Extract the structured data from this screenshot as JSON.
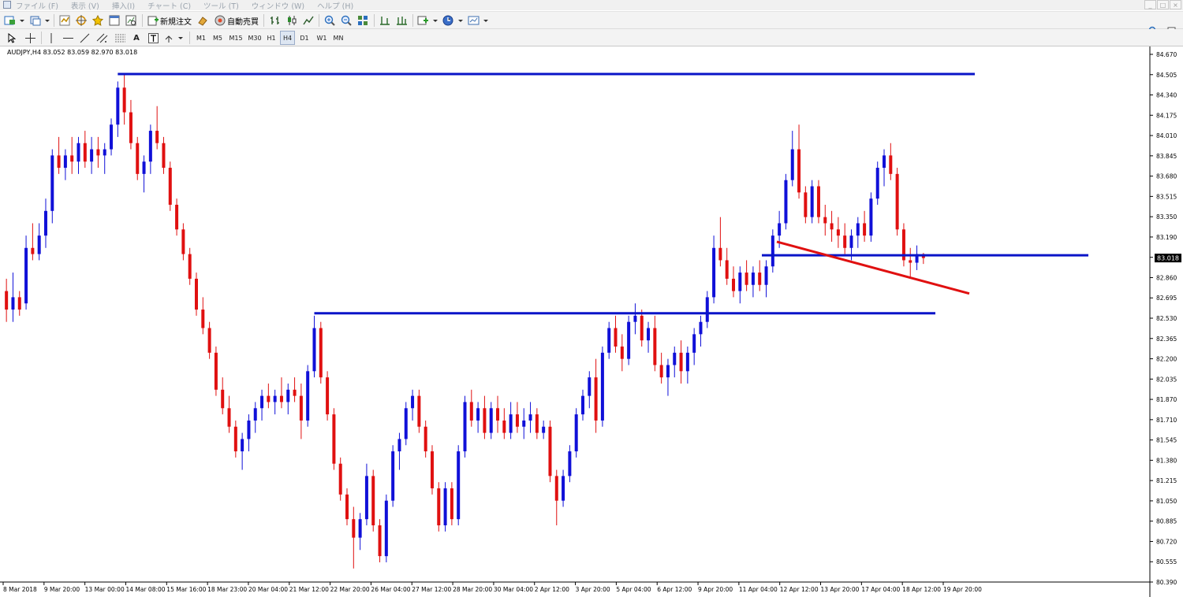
{
  "menu": {
    "items": [
      "ファイル (F)",
      "表示 (V)",
      "挿入(I)",
      "チャート (C)",
      "ツール (T)",
      "ウィンドウ (W)",
      "ヘルプ (H)"
    ],
    "window_controls": [
      "_",
      "□",
      "×"
    ]
  },
  "toolbar": {
    "new_order_label": "新規注文",
    "auto_trade_label": "自動売買",
    "timeframes": [
      "M1",
      "M5",
      "M15",
      "M30",
      "H1",
      "H4",
      "D1",
      "W1",
      "MN"
    ],
    "active_timeframe": "H4"
  },
  "chart": {
    "symbol_line": "AUDJPY,H4  83.052 83.059 82.970 83.018",
    "current_price_label": "83.018",
    "colors": {
      "bull": "#1010d8",
      "bear": "#e01010",
      "hline": "#0a14c8",
      "trendline": "#e01010",
      "price_tag_bg": "#000000"
    }
  },
  "chart_data": {
    "type": "candlestick",
    "price_axis_ticks": [
      "84.670",
      "84.505",
      "84.340",
      "84.175",
      "84.010",
      "83.845",
      "83.680",
      "83.515",
      "83.350",
      "83.190",
      "83.025",
      "82.860",
      "82.695",
      "82.530",
      "82.365",
      "82.200",
      "82.035",
      "81.870",
      "81.710",
      "81.545",
      "81.380",
      "81.215",
      "81.050",
      "80.885",
      "80.720",
      "80.555",
      "80.390"
    ],
    "time_axis_labels": [
      "8 Mar 2018",
      "9 Mar 20:00",
      "13 Mar 00:00",
      "14 Mar 08:00",
      "15 Mar 16:00",
      "18 Mar 23:00",
      "20 Mar 04:00",
      "21 Mar 12:00",
      "22 Mar 20:00",
      "26 Mar 04:00",
      "27 Mar 12:00",
      "28 Mar 20:00",
      "30 Mar 04:00",
      "2 Apr 12:00",
      "3 Apr 20:00",
      "5 Apr 04:00",
      "6 Apr 12:00",
      "9 Apr 20:00",
      "11 Apr 04:00",
      "12 Apr 12:00",
      "13 Apr 20:00",
      "17 Apr 04:00",
      "18 Apr 12:00",
      "19 Apr 20:00"
    ],
    "ylim": [
      80.39,
      84.67
    ],
    "horizontal_lines": [
      84.51,
      82.57,
      83.04
    ],
    "trendline": {
      "from_price": 83.15,
      "to_price": 82.73
    },
    "current_price": 83.018,
    "ohlc": [
      [
        82.75,
        82.85,
        82.5,
        82.6
      ],
      [
        82.6,
        82.9,
        82.5,
        82.7
      ],
      [
        82.7,
        82.75,
        82.55,
        82.6
      ],
      [
        82.65,
        83.2,
        82.6,
        83.1
      ],
      [
        83.1,
        83.3,
        83.0,
        83.05
      ],
      [
        83.05,
        83.3,
        83.0,
        83.2
      ],
      [
        83.2,
        83.5,
        83.1,
        83.4
      ],
      [
        83.4,
        83.9,
        83.3,
        83.85
      ],
      [
        83.85,
        84.0,
        83.7,
        83.75
      ],
      [
        83.75,
        83.9,
        83.65,
        83.85
      ],
      [
        83.85,
        84.0,
        83.7,
        83.8
      ],
      [
        83.8,
        84.0,
        83.7,
        83.95
      ],
      [
        83.95,
        84.05,
        83.75,
        83.8
      ],
      [
        83.8,
        84.0,
        83.7,
        83.9
      ],
      [
        83.9,
        84.0,
        83.75,
        83.85
      ],
      [
        83.85,
        83.95,
        83.7,
        83.9
      ],
      [
        83.9,
        84.15,
        83.85,
        84.1
      ],
      [
        84.1,
        84.45,
        84.0,
        84.4
      ],
      [
        84.4,
        84.51,
        84.1,
        84.2
      ],
      [
        84.2,
        84.3,
        83.9,
        83.95
      ],
      [
        83.95,
        84.0,
        83.65,
        83.7
      ],
      [
        83.7,
        83.85,
        83.55,
        83.8
      ],
      [
        83.8,
        84.1,
        83.7,
        84.05
      ],
      [
        84.05,
        84.25,
        83.9,
        83.95
      ],
      [
        83.95,
        84.0,
        83.7,
        83.75
      ],
      [
        83.75,
        83.8,
        83.4,
        83.45
      ],
      [
        83.45,
        83.5,
        83.2,
        83.25
      ],
      [
        83.25,
        83.3,
        83.0,
        83.05
      ],
      [
        83.05,
        83.1,
        82.8,
        82.85
      ],
      [
        82.85,
        82.9,
        82.55,
        82.6
      ],
      [
        82.6,
        82.7,
        82.4,
        82.45
      ],
      [
        82.45,
        82.5,
        82.2,
        82.25
      ],
      [
        82.25,
        82.3,
        81.9,
        81.95
      ],
      [
        81.95,
        82.05,
        81.75,
        81.8
      ],
      [
        81.8,
        81.9,
        81.6,
        81.65
      ],
      [
        81.65,
        81.7,
        81.4,
        81.45
      ],
      [
        81.45,
        81.6,
        81.3,
        81.55
      ],
      [
        81.55,
        81.75,
        81.45,
        81.7
      ],
      [
        81.7,
        81.85,
        81.6,
        81.8
      ],
      [
        81.8,
        81.95,
        81.7,
        81.9
      ],
      [
        81.9,
        82.0,
        81.8,
        81.85
      ],
      [
        81.85,
        81.95,
        81.75,
        81.9
      ],
      [
        81.9,
        82.05,
        81.8,
        81.85
      ],
      [
        81.85,
        82.0,
        81.75,
        81.95
      ],
      [
        81.95,
        82.05,
        81.85,
        81.9
      ],
      [
        81.9,
        82.0,
        81.55,
        81.7
      ],
      [
        81.7,
        82.15,
        81.65,
        82.1
      ],
      [
        82.1,
        82.55,
        82.05,
        82.45
      ],
      [
        82.45,
        82.5,
        82.0,
        82.05
      ],
      [
        82.05,
        82.1,
        81.7,
        81.75
      ],
      [
        81.75,
        81.8,
        81.3,
        81.35
      ],
      [
        81.35,
        81.4,
        81.05,
        81.1
      ],
      [
        81.1,
        81.15,
        80.85,
        80.9
      ],
      [
        80.9,
        81.0,
        80.5,
        80.75
      ],
      [
        80.75,
        80.95,
        80.65,
        80.9
      ],
      [
        80.9,
        81.35,
        80.85,
        81.25
      ],
      [
        81.25,
        81.3,
        80.8,
        80.85
      ],
      [
        80.85,
        80.9,
        80.55,
        80.6
      ],
      [
        80.6,
        81.1,
        80.55,
        81.05
      ],
      [
        81.05,
        81.5,
        81.0,
        81.45
      ],
      [
        81.45,
        81.6,
        81.3,
        81.55
      ],
      [
        81.55,
        81.85,
        81.5,
        81.8
      ],
      [
        81.8,
        81.95,
        81.7,
        81.9
      ],
      [
        81.9,
        81.95,
        81.6,
        81.65
      ],
      [
        81.65,
        81.7,
        81.4,
        81.45
      ],
      [
        81.45,
        81.5,
        81.1,
        81.15
      ],
      [
        81.15,
        81.2,
        80.8,
        80.85
      ],
      [
        80.85,
        81.2,
        80.8,
        81.15
      ],
      [
        81.15,
        81.2,
        80.85,
        80.9
      ],
      [
        80.9,
        81.5,
        80.85,
        81.45
      ],
      [
        81.45,
        81.9,
        81.4,
        81.85
      ],
      [
        81.85,
        81.95,
        81.65,
        81.7
      ],
      [
        81.7,
        81.85,
        81.6,
        81.8
      ],
      [
        81.8,
        81.9,
        81.55,
        81.6
      ],
      [
        81.6,
        81.85,
        81.55,
        81.8
      ],
      [
        81.8,
        81.9,
        81.6,
        81.7
      ],
      [
        81.7,
        81.8,
        81.55,
        81.6
      ],
      [
        81.6,
        81.85,
        81.55,
        81.75
      ],
      [
        81.75,
        81.85,
        81.6,
        81.65
      ],
      [
        81.65,
        81.8,
        81.55,
        81.7
      ],
      [
        81.7,
        81.85,
        81.6,
        81.75
      ],
      [
        81.75,
        81.8,
        81.55,
        81.6
      ],
      [
        81.6,
        81.7,
        81.55,
        81.65
      ],
      [
        81.65,
        81.7,
        81.2,
        81.25
      ],
      [
        81.25,
        81.3,
        80.85,
        81.05
      ],
      [
        81.05,
        81.3,
        81.0,
        81.25
      ],
      [
        81.25,
        81.5,
        81.2,
        81.45
      ],
      [
        81.45,
        81.8,
        81.4,
        81.75
      ],
      [
        81.75,
        81.95,
        81.7,
        81.9
      ],
      [
        81.9,
        82.1,
        81.8,
        82.05
      ],
      [
        82.05,
        82.2,
        81.6,
        81.7
      ],
      [
        81.7,
        82.3,
        81.65,
        82.25
      ],
      [
        82.25,
        82.5,
        82.2,
        82.45
      ],
      [
        82.45,
        82.55,
        82.25,
        82.3
      ],
      [
        82.3,
        82.4,
        82.1,
        82.2
      ],
      [
        82.2,
        82.55,
        82.15,
        82.5
      ],
      [
        82.5,
        82.65,
        82.4,
        82.55
      ],
      [
        82.55,
        82.6,
        82.3,
        82.35
      ],
      [
        82.35,
        82.5,
        82.25,
        82.45
      ],
      [
        82.45,
        82.55,
        82.1,
        82.15
      ],
      [
        82.15,
        82.25,
        82.0,
        82.05
      ],
      [
        82.05,
        82.2,
        81.9,
        82.15
      ],
      [
        82.15,
        82.3,
        82.05,
        82.25
      ],
      [
        82.25,
        82.35,
        82.0,
        82.1
      ],
      [
        82.1,
        82.3,
        82.0,
        82.25
      ],
      [
        82.25,
        82.45,
        82.15,
        82.4
      ],
      [
        82.4,
        82.55,
        82.3,
        82.5
      ],
      [
        82.5,
        82.75,
        82.45,
        82.7
      ],
      [
        82.7,
        83.2,
        82.65,
        83.1
      ],
      [
        83.1,
        83.35,
        82.95,
        83.0
      ],
      [
        83.0,
        83.1,
        82.8,
        82.85
      ],
      [
        82.85,
        82.95,
        82.7,
        82.75
      ],
      [
        82.75,
        82.95,
        82.65,
        82.9
      ],
      [
        82.9,
        83.0,
        82.75,
        82.8
      ],
      [
        82.8,
        82.95,
        82.7,
        82.9
      ],
      [
        82.9,
        83.0,
        82.75,
        82.8
      ],
      [
        82.8,
        83.0,
        82.7,
        82.95
      ],
      [
        82.95,
        83.25,
        82.9,
        83.2
      ],
      [
        83.2,
        83.4,
        83.1,
        83.3
      ],
      [
        83.3,
        83.7,
        83.25,
        83.65
      ],
      [
        83.65,
        84.05,
        83.6,
        83.9
      ],
      [
        83.9,
        84.1,
        83.5,
        83.55
      ],
      [
        83.55,
        83.6,
        83.3,
        83.35
      ],
      [
        83.35,
        83.65,
        83.3,
        83.6
      ],
      [
        83.6,
        83.65,
        83.3,
        83.35
      ],
      [
        83.35,
        83.45,
        83.2,
        83.3
      ],
      [
        83.3,
        83.4,
        83.15,
        83.25
      ],
      [
        83.25,
        83.35,
        83.1,
        83.2
      ],
      [
        83.2,
        83.3,
        83.05,
        83.1
      ],
      [
        83.1,
        83.25,
        83.0,
        83.2
      ],
      [
        83.2,
        83.35,
        83.1,
        83.3
      ],
      [
        83.3,
        83.4,
        83.15,
        83.2
      ],
      [
        83.2,
        83.55,
        83.15,
        83.5
      ],
      [
        83.5,
        83.8,
        83.45,
        83.75
      ],
      [
        83.75,
        83.9,
        83.6,
        83.85
      ],
      [
        83.85,
        83.95,
        83.65,
        83.7
      ],
      [
        83.7,
        83.75,
        83.2,
        83.25
      ],
      [
        83.25,
        83.3,
        82.95,
        83.0
      ],
      [
        83.0,
        83.1,
        82.85,
        82.98
      ],
      [
        82.98,
        83.12,
        82.92,
        83.05
      ],
      [
        83.05,
        83.059,
        82.97,
        83.018
      ]
    ]
  }
}
